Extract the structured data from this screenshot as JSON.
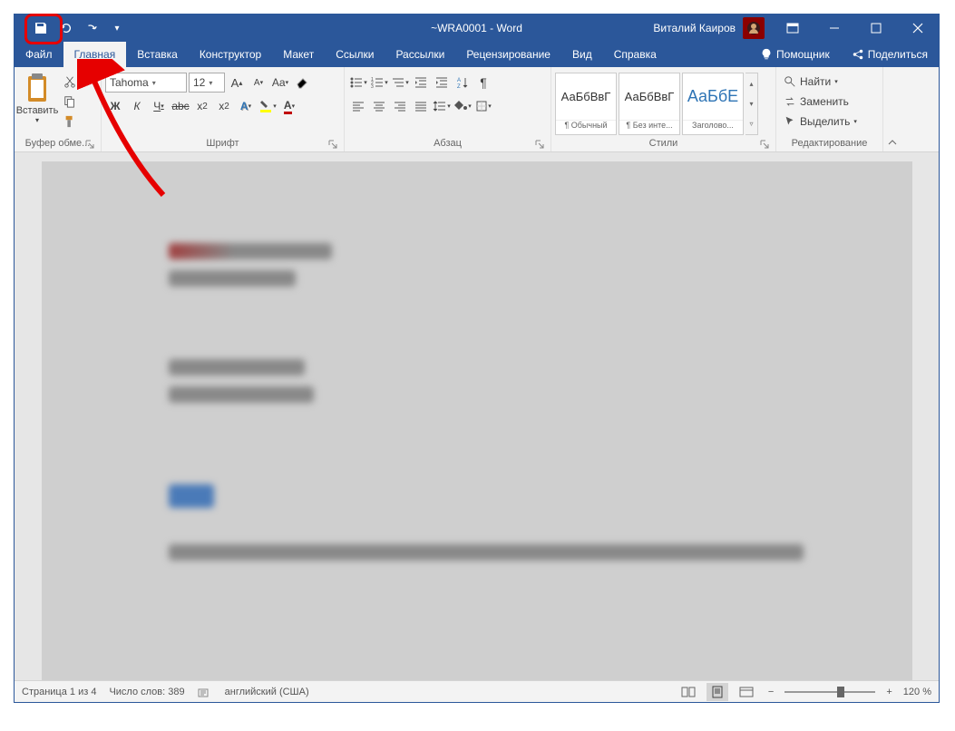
{
  "title": "~WRA0001 - Word",
  "user": "Виталий Каиров",
  "tabs": {
    "file": "Файл",
    "home": "Главная",
    "insert": "Вставка",
    "design": "Конструктор",
    "layout": "Макет",
    "references": "Ссылки",
    "mailings": "Рассылки",
    "review": "Рецензирование",
    "view": "Вид",
    "help": "Справка",
    "assistant": "Помощник",
    "share": "Поделиться"
  },
  "clipboard": {
    "label": "Буфер обме...",
    "paste": "Вставить"
  },
  "font": {
    "label": "Шрифт",
    "name": "Tahoma",
    "size": "12"
  },
  "paragraph": {
    "label": "Абзац"
  },
  "styles": {
    "label": "Стили",
    "preview": "АаБбВвГ",
    "preview_heading": "АаБбЕ",
    "normal": "¶ Обычный",
    "nospacing": "¶ Без инте...",
    "heading1": "Заголово..."
  },
  "editing": {
    "label": "Редактирование",
    "find": "Найти",
    "replace": "Заменить",
    "select": "Выделить"
  },
  "status": {
    "page": "Страница 1 из 4",
    "words": "Число слов: 389",
    "lang": "английский (США)",
    "zoom": "120 %"
  }
}
